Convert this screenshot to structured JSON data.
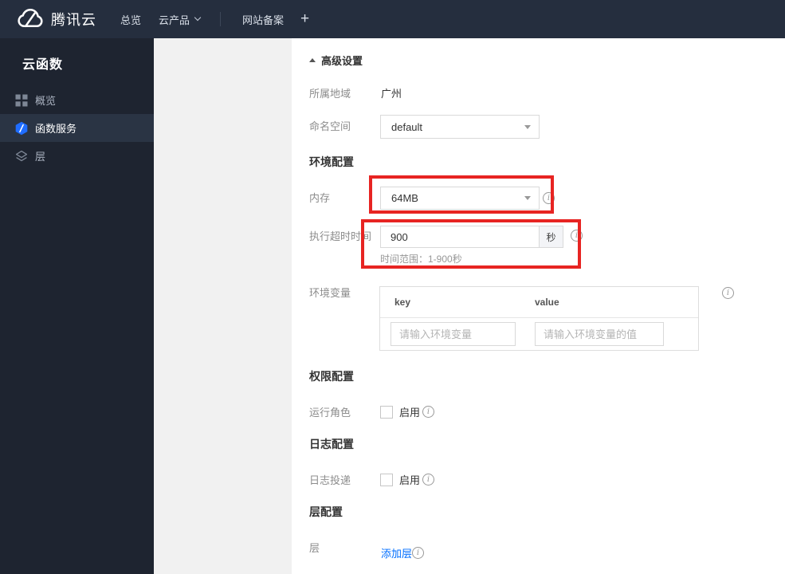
{
  "navbar": {
    "brand": "腾讯云",
    "overview": "总览",
    "products": "云产品",
    "icp": "网站备案",
    "plus": "+"
  },
  "sidebar": {
    "title": "云函数",
    "items": [
      {
        "label": "概览",
        "icon": "grid-icon"
      },
      {
        "label": "函数服务",
        "icon": "scf-hexagon-icon"
      },
      {
        "label": "层",
        "icon": "layers-icon"
      }
    ]
  },
  "main": {
    "advanced_settings": "高级设置",
    "region_label": "所属地域",
    "region_value": "广州",
    "namespace_label": "命名空间",
    "namespace_value": "default",
    "env_config_title": "环境配置",
    "memory_label": "内存",
    "memory_value": "64MB",
    "timeout_label": "执行超时时间",
    "timeout_value": "900",
    "timeout_unit": "秒",
    "timeout_hint": "时间范围：1-900秒",
    "env_vars_label": "环境变量",
    "env_key_header": "key",
    "env_value_header": "value",
    "env_key_placeholder": "请输入环境变量",
    "env_value_placeholder": "请输入环境变量的值",
    "perm_config_title": "权限配置",
    "run_role_label": "运行角色",
    "run_role_enable": "启用",
    "log_config_title": "日志配置",
    "log_delivery_label": "日志投递",
    "log_delivery_enable": "启用",
    "layer_config_title": "层配置",
    "layer_label": "层",
    "add_layer_link": "添加层"
  },
  "colors": {
    "navbar_bg": "#252e3e",
    "sidebar_bg": "#1e2430",
    "sidebar_active_bg": "#2a3444",
    "highlight_red": "#e72422",
    "link_blue": "#006eff",
    "scf_icon_blue": "#1f6dff"
  }
}
